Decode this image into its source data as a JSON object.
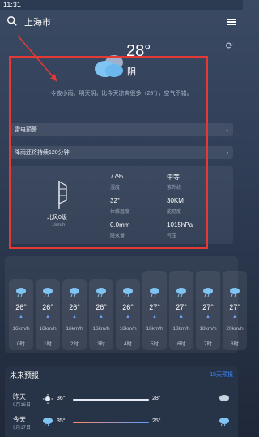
{
  "status": {
    "time": "11:31"
  },
  "header": {
    "city": "上海市"
  },
  "current": {
    "temperature": "28°",
    "condition": "阴",
    "summary": "今夜小雨。明天阴，比今天凉爽很多（28°），空气不错。"
  },
  "alerts": [
    {
      "label": "雷电预警"
    },
    {
      "label": "降雨还将持续120分钟"
    }
  ],
  "details": {
    "wind": {
      "label": "北风0级",
      "speed": "1km/h"
    },
    "items": [
      {
        "value": "77%",
        "label": "湿度"
      },
      {
        "value": "中等",
        "label": "紫外线"
      },
      {
        "value": "32°",
        "label": "体感温度"
      },
      {
        "value": "30KM",
        "label": "能见度"
      },
      {
        "value": "0.0mm",
        "label": "降水量"
      },
      {
        "value": "1015hPa",
        "label": "气压"
      }
    ]
  },
  "hourly": [
    {
      "temp": "26°",
      "speed": "16km/h",
      "time": "0时"
    },
    {
      "temp": "26°",
      "speed": "16km/h",
      "time": "1时"
    },
    {
      "temp": "26°",
      "speed": "16km/h",
      "time": "2时"
    },
    {
      "temp": "26°",
      "speed": "16km/h",
      "time": "3时"
    },
    {
      "temp": "26°",
      "speed": "16km/h",
      "time": "4时"
    },
    {
      "temp": "27°",
      "speed": "16km/h",
      "time": "5时"
    },
    {
      "temp": "27°",
      "speed": "18km/h",
      "time": "6时"
    },
    {
      "temp": "27°",
      "speed": "18km/h",
      "time": "7时"
    },
    {
      "temp": "27°",
      "speed": "20km/h",
      "time": "8时"
    }
  ],
  "forecast": {
    "title": "未来预报",
    "more": "15天预报",
    "days": [
      {
        "day": "昨天",
        "date": "9月16日",
        "low": "36°",
        "high": "28°"
      },
      {
        "day": "今天",
        "date": "9月17日",
        "low": "35°",
        "high": "25°"
      }
    ]
  },
  "colors": {
    "accent": "#3d8bff",
    "highlight": "#e53935"
  }
}
